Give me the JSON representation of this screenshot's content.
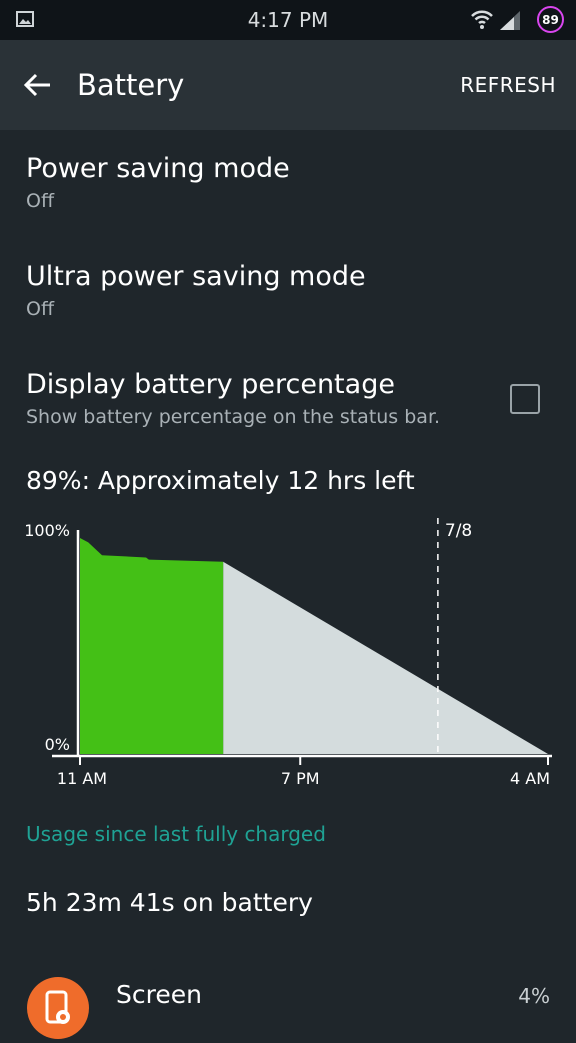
{
  "status_bar": {
    "time": "4:17 PM",
    "battery_level": "89",
    "icons": [
      "image-notification-icon",
      "wifi-icon",
      "signal-icon",
      "battery-circle-icon"
    ],
    "battery_ring_color": "#d946ef"
  },
  "app_bar": {
    "title": "Battery",
    "action": "REFRESH",
    "back_icon": "arrow-left-icon"
  },
  "settings": [
    {
      "label": "Power saving mode",
      "sub": "Off"
    },
    {
      "label": "Ultra power saving mode",
      "sub": "Off"
    },
    {
      "label": "Display battery percentage",
      "sub": "Show battery percentage on the status bar.",
      "checked": false
    }
  ],
  "estimate": "89%: Approximately 12 hrs left",
  "chart_data": {
    "type": "area",
    "y_top_label": "100%",
    "y_bottom_label": "0%",
    "x_tick_labels": [
      "11 AM",
      "7 PM",
      "4 AM"
    ],
    "marker_label": "7/8",
    "ylim": [
      0,
      100
    ],
    "measured_color": "#44c016",
    "predicted_color": "#d4dcdd",
    "measured_series": {
      "name": "",
      "hours_from_start": [
        0.0,
        0.3,
        0.8,
        2.4,
        2.5,
        5.2
      ],
      "battery_percent": [
        100,
        98,
        92,
        91,
        90,
        89
      ]
    },
    "predicted_series": {
      "name": "",
      "hours_from_start": [
        5.2,
        17.0
      ],
      "battery_percent": [
        89,
        0
      ]
    },
    "x_tick_hours": [
      0,
      8,
      17
    ],
    "marker_hours": 13.0,
    "x_end_hours": 17.0
  },
  "usage_header": "Usage since last fully charged",
  "on_battery": "5h 23m 41s on battery",
  "apps": [
    {
      "name": "Screen",
      "percent": "4%",
      "icon": "screen-settings-icon",
      "icon_color": "#ef6c2b"
    }
  ]
}
